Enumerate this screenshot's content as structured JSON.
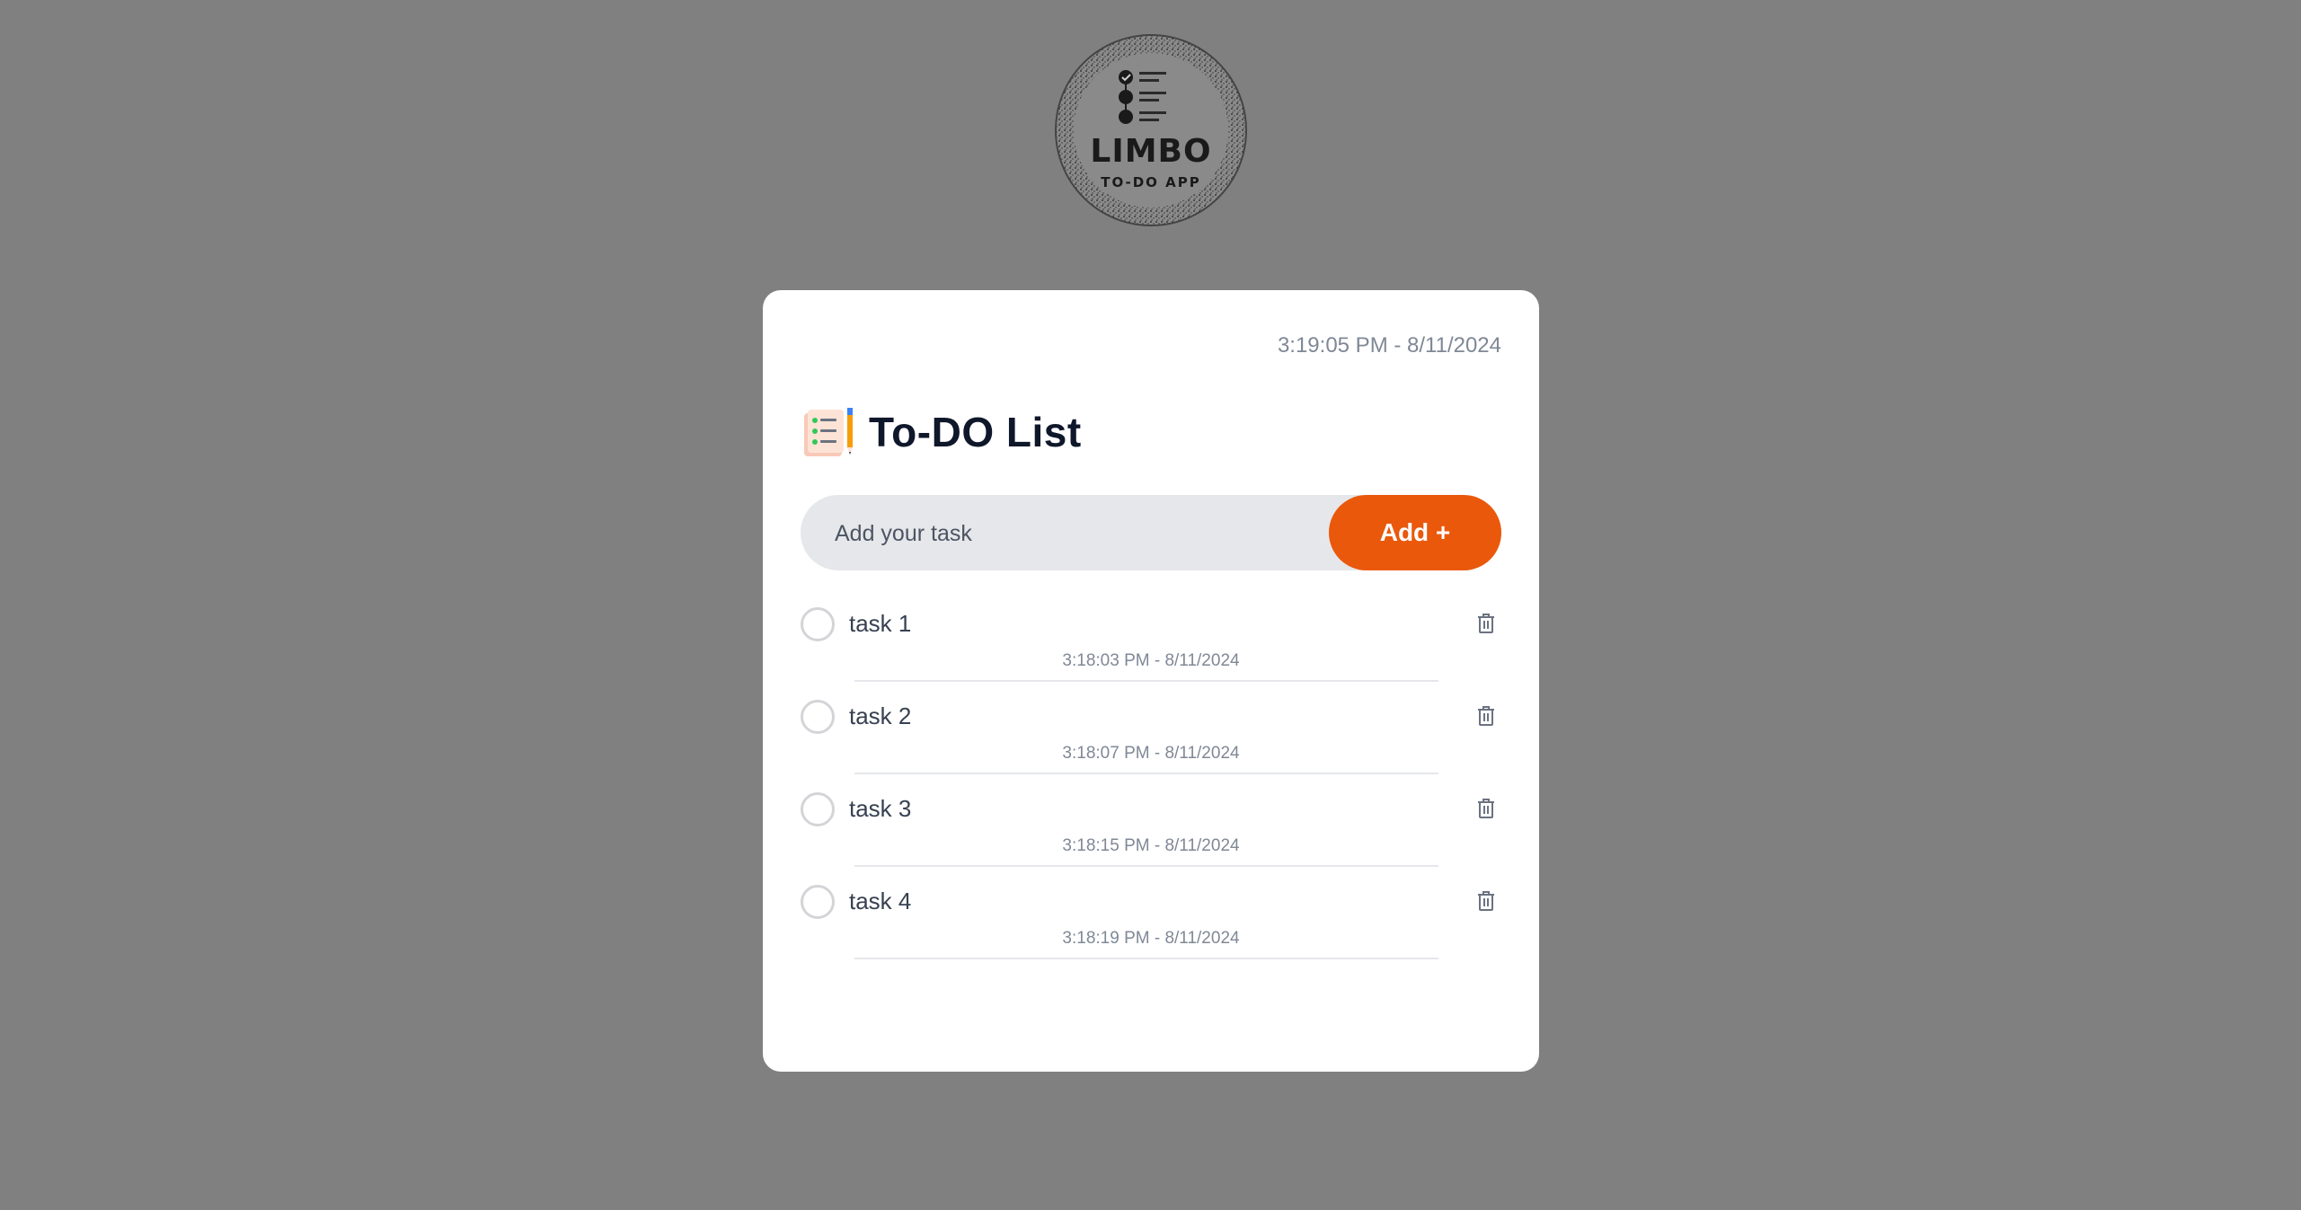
{
  "logo": {
    "brand": "LIMBO",
    "tagline": "TO-DO APP",
    "alt": "LIMBO TO-DO APP logo"
  },
  "card": {
    "clock": "3:19:05 PM - 8/11/2024",
    "title": "To-DO List",
    "title_icon": "checklist-notepad-pencil-icon"
  },
  "add_form": {
    "placeholder": "Add your task",
    "value": "",
    "button_label": "Add +"
  },
  "tasks": [
    {
      "label": "task 1",
      "time": "3:18:03 PM - 8/11/2024",
      "completed": false
    },
    {
      "label": "task 2",
      "time": "3:18:07 PM - 8/11/2024",
      "completed": false
    },
    {
      "label": "task 3",
      "time": "3:18:15 PM - 8/11/2024",
      "completed": false
    },
    {
      "label": "task 4",
      "time": "3:18:19 PM - 8/11/2024",
      "completed": false
    }
  ],
  "icons": {
    "delete": "trash-icon",
    "check": "unchecked-circle-icon"
  },
  "colors": {
    "background": "#808080",
    "card": "#ffffff",
    "accent": "#ea580c",
    "input_bg": "#e6e7ea",
    "muted_text": "#7f8896"
  }
}
